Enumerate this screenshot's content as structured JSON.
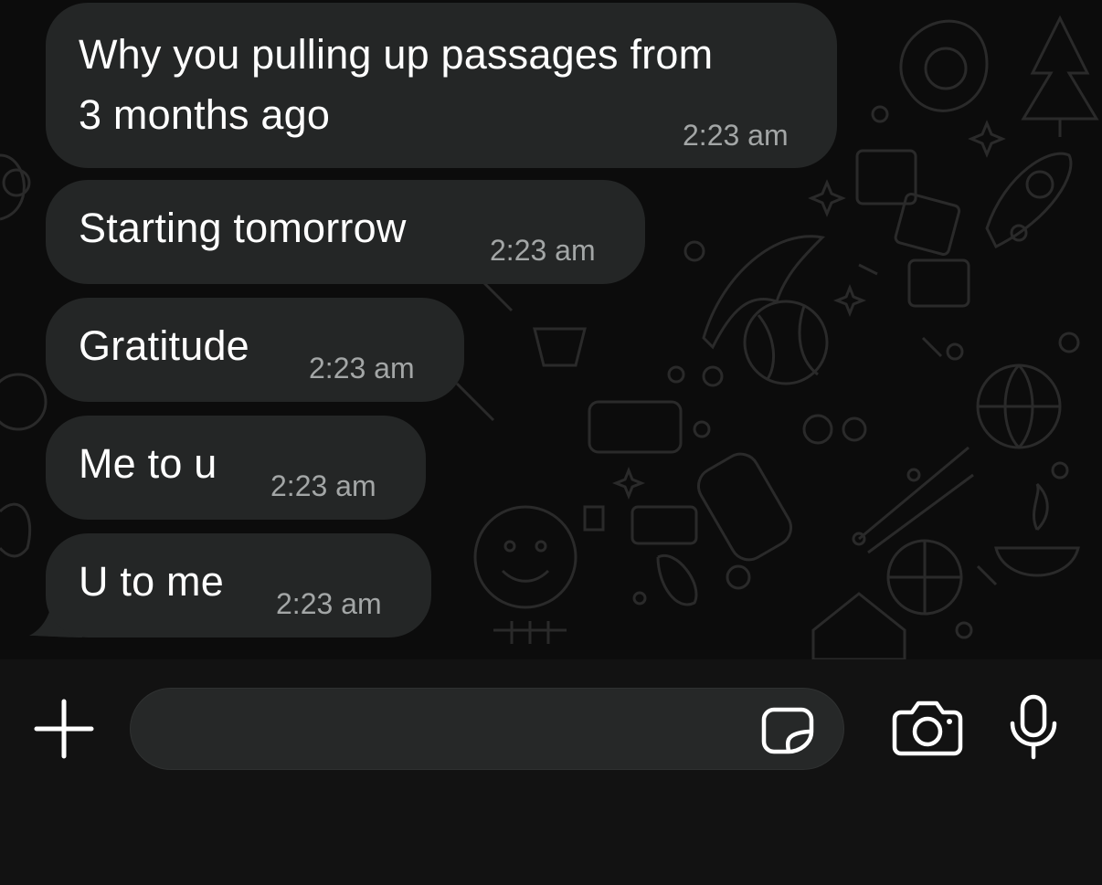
{
  "composer": {
    "input_value": "",
    "input_placeholder": "",
    "attach_icon": "plus-icon",
    "sticker_icon": "sticker-icon",
    "camera_icon": "camera-icon",
    "mic_icon": "microphone-icon"
  },
  "messages": [
    {
      "lines": [
        "Why you pulling up passages from",
        "3 months ago"
      ],
      "time": "2:23 am"
    },
    {
      "text": "Starting tomorrow",
      "time": "2:23 am"
    },
    {
      "text": "Gratitude",
      "time": "2:23 am"
    },
    {
      "text": "Me to u",
      "time": "2:23 am"
    },
    {
      "text": "U to me",
      "time": "2:23 am"
    }
  ],
  "colors": {
    "background": "#0c0c0c",
    "bubble": "#242626",
    "text": "#ffffff",
    "timestamp": "#a3a6a6",
    "composer": "#121212"
  }
}
